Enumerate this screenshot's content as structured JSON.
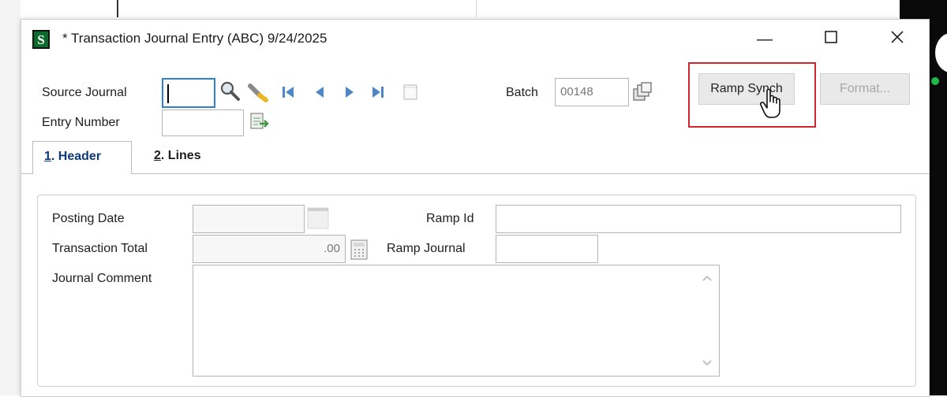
{
  "window": {
    "title": "* Transaction Journal Entry (ABC) 9/24/2025",
    "app_icon_letter": "S",
    "minimize_glyph": "—",
    "maximize_glyph": "☐",
    "close_glyph": "✕"
  },
  "header_fields": {
    "source_journal_label": "Source Journal",
    "source_journal_value": "",
    "entry_number_label": "Entry Number",
    "entry_number_value": "",
    "batch_label": "Batch",
    "batch_value": "00148"
  },
  "toolbar": {
    "icons": [
      "search-icon",
      "clear-icon",
      "first-record-icon",
      "previous-record-icon",
      "next-record-icon",
      "last-record-icon",
      "memo-icon",
      "batch-lookup-icon",
      "next-entry-icon"
    ]
  },
  "buttons": {
    "ramp_synch": "Ramp Synch",
    "format": "Format..."
  },
  "tabs": [
    {
      "mnemonic": "1",
      "label": ". Header"
    },
    {
      "mnemonic": "2",
      "label": ". Lines"
    }
  ],
  "form": {
    "posting_date_label": "Posting Date",
    "posting_date_value": "",
    "transaction_total_label": "Transaction Total",
    "transaction_total_value": ".00",
    "journal_comment_label": "Journal Comment",
    "journal_comment_value": "",
    "ramp_id_label": "Ramp Id",
    "ramp_id_value": "",
    "ramp_journal_label": "Ramp Journal",
    "ramp_journal_value": ""
  },
  "colors": {
    "highlight": "#d0262b",
    "focus": "#2f7fd1",
    "tab_active_text": "#0f3a7a"
  }
}
